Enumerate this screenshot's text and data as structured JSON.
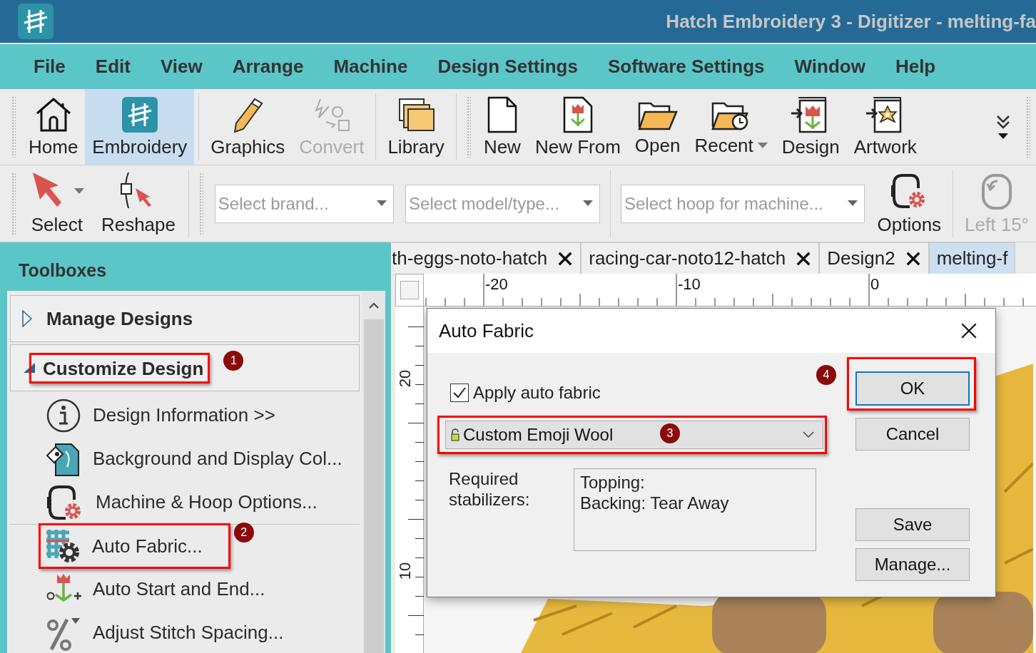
{
  "window": {
    "title": "Hatch Embroidery 3 - Digitizer - melting-fa"
  },
  "menu": [
    "File",
    "Edit",
    "View",
    "Arrange",
    "Machine",
    "Design Settings",
    "Software Settings",
    "Window",
    "Help"
  ],
  "toolbar": {
    "groups": [
      {
        "items": [
          {
            "label": "Home",
            "kind": "home",
            "selected": false,
            "disabled": false,
            "dropdown": false
          },
          {
            "label": "Embroidery",
            "kind": "embroidery",
            "selected": true,
            "disabled": false,
            "dropdown": false
          }
        ]
      },
      {
        "items": [
          {
            "label": "Graphics",
            "kind": "graphics",
            "selected": false,
            "disabled": false,
            "dropdown": false
          },
          {
            "label": "Convert",
            "kind": "convert",
            "selected": false,
            "disabled": true,
            "dropdown": false
          }
        ]
      },
      {
        "items": [
          {
            "label": "Library",
            "kind": "library",
            "selected": false,
            "disabled": false,
            "dropdown": false
          }
        ]
      },
      {
        "items": [
          {
            "label": "New",
            "kind": "new",
            "selected": false,
            "disabled": false,
            "dropdown": false
          },
          {
            "label": "New From",
            "kind": "new_from",
            "selected": false,
            "disabled": false,
            "dropdown": false
          },
          {
            "label": "Open",
            "kind": "open",
            "selected": false,
            "disabled": false,
            "dropdown": false
          },
          {
            "label": "Recent",
            "kind": "recent",
            "selected": false,
            "disabled": false,
            "dropdown": true
          },
          {
            "label": "Design",
            "kind": "design",
            "selected": false,
            "disabled": false,
            "dropdown": false
          },
          {
            "label": "Artwork",
            "kind": "artwork",
            "selected": false,
            "disabled": false,
            "dropdown": false
          }
        ]
      }
    ]
  },
  "toolbar2": {
    "tools": [
      {
        "label": "Select",
        "kind": "select",
        "dropdown": true
      },
      {
        "label": "Reshape",
        "kind": "reshape",
        "dropdown": false
      }
    ],
    "combos": [
      {
        "placeholder": "Select brand..."
      },
      {
        "placeholder": "Select model/type..."
      },
      {
        "placeholder": "Select hoop for machine..."
      }
    ],
    "actions": [
      {
        "label": "Options",
        "kind": "hoop_options",
        "disabled": false
      },
      {
        "label": "Left 15°",
        "kind": "rotate_left",
        "disabled": true
      }
    ]
  },
  "toolboxes": {
    "title": "Toolboxes",
    "sections": [
      {
        "title": "Manage Designs",
        "expanded": false
      },
      {
        "title": "Customize Design",
        "expanded": true,
        "callout": "1",
        "items": [
          {
            "label": "Design Information >>",
            "kind": "info",
            "divider_above": false
          },
          {
            "label": "Background and Display Col...",
            "kind": "background",
            "divider_above": false
          },
          {
            "label": "Machine & Hoop Options...",
            "kind": "hoop_options",
            "divider_above": false
          },
          {
            "label": "Auto Fabric...",
            "kind": "auto_fabric",
            "divider_above": true,
            "callout": "2"
          },
          {
            "label": "Auto Start and End...",
            "kind": "start_end",
            "divider_above": false
          },
          {
            "label": "Adjust Stitch Spacing...",
            "kind": "spacing",
            "divider_above": false
          }
        ]
      }
    ]
  },
  "tabs": [
    {
      "label": "th-eggs-noto-hatch",
      "selected": false
    },
    {
      "label": "racing-car-noto12-hatch",
      "selected": false
    },
    {
      "label": "Design2",
      "selected": false
    },
    {
      "label": "melting-f",
      "selected": true
    }
  ],
  "rulers": {
    "horizontal": [
      "-20",
      "-10",
      "0"
    ],
    "vertical": [
      "20",
      "10"
    ]
  },
  "dialog": {
    "title": "Auto Fabric",
    "apply": {
      "label": "Apply auto fabric",
      "checked": true
    },
    "fabric": {
      "value": "Custom Emoji Wool",
      "callout": "3"
    },
    "stabilizers": {
      "label": "Required stabilizers:",
      "lines": [
        "Topping:",
        "Backing: Tear Away"
      ]
    },
    "button_groups": [
      {
        "buttons": [
          {
            "label": "OK",
            "focused": true,
            "callout": "4"
          },
          {
            "label": "Cancel",
            "focused": false
          }
        ]
      },
      {
        "buttons": [
          {
            "label": "Save",
            "focused": false
          },
          {
            "label": "Manage...",
            "focused": false
          }
        ]
      }
    ]
  }
}
